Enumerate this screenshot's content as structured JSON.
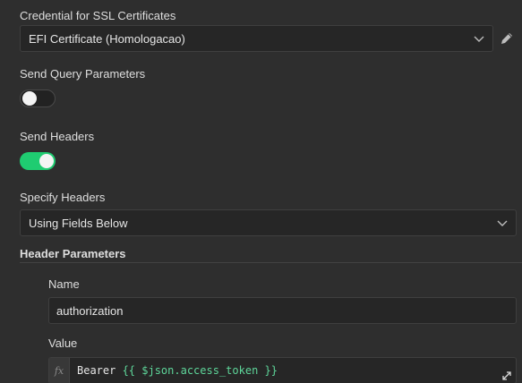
{
  "ssl": {
    "label": "Credential for SSL Certificates",
    "selected": "EFI Certificate (Homologacao)"
  },
  "query_params": {
    "label": "Send Query Parameters",
    "enabled": false
  },
  "headers": {
    "label": "Send Headers",
    "enabled": true
  },
  "specify_headers": {
    "label": "Specify Headers",
    "selected": "Using Fields Below"
  },
  "header_parameters": {
    "title": "Header Parameters",
    "name_label": "Name",
    "name_value": "authorization",
    "value_label": "Value",
    "value_fx": "fx",
    "value_plain": "Bearer ",
    "value_expression": "{{ $json.access_token }}"
  },
  "colors": {
    "toggle_on": "#1fcc71",
    "expression": "#5ed69a"
  },
  "icons": {
    "edit": "pencil-icon",
    "dropdown": "chevron-down-icon",
    "expand": "expand-icon"
  }
}
